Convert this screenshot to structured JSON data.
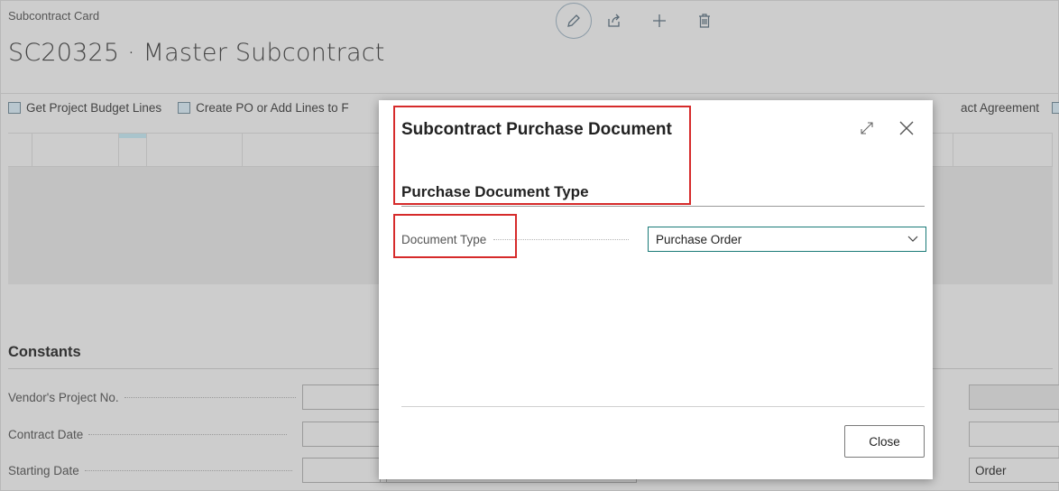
{
  "page": {
    "breadcrumb": "Subcontract Card",
    "title": "SC20325 · Master Subcontract"
  },
  "action_bar": {
    "get_budget_label": "Get Project Budget Lines",
    "create_po_label": "Create PO or Add Lines to F",
    "contract_agreement_label": "act Agreement"
  },
  "constants": {
    "title": "Constants",
    "rows": [
      {
        "label": "Vendor's Project No."
      },
      {
        "label": "Contract Date"
      },
      {
        "label": "Starting Date"
      }
    ],
    "right_value": "Order"
  },
  "modal": {
    "title": "Subcontract Purchase Document",
    "group_title": "Purchase Document Type",
    "field_label": "Document Type",
    "field_value": "Purchase Order",
    "close_label": "Close"
  },
  "colors": {
    "accent": "#1a7a78",
    "highlight": "#d62b2b",
    "overlay": "#cdcdcd"
  },
  "icons": {
    "edit": "pencil-icon",
    "share": "share-icon",
    "new": "plus-icon",
    "delete": "trash-icon",
    "expand": "expand-icon",
    "close": "close-icon",
    "dropdown": "chevron-down-icon"
  }
}
